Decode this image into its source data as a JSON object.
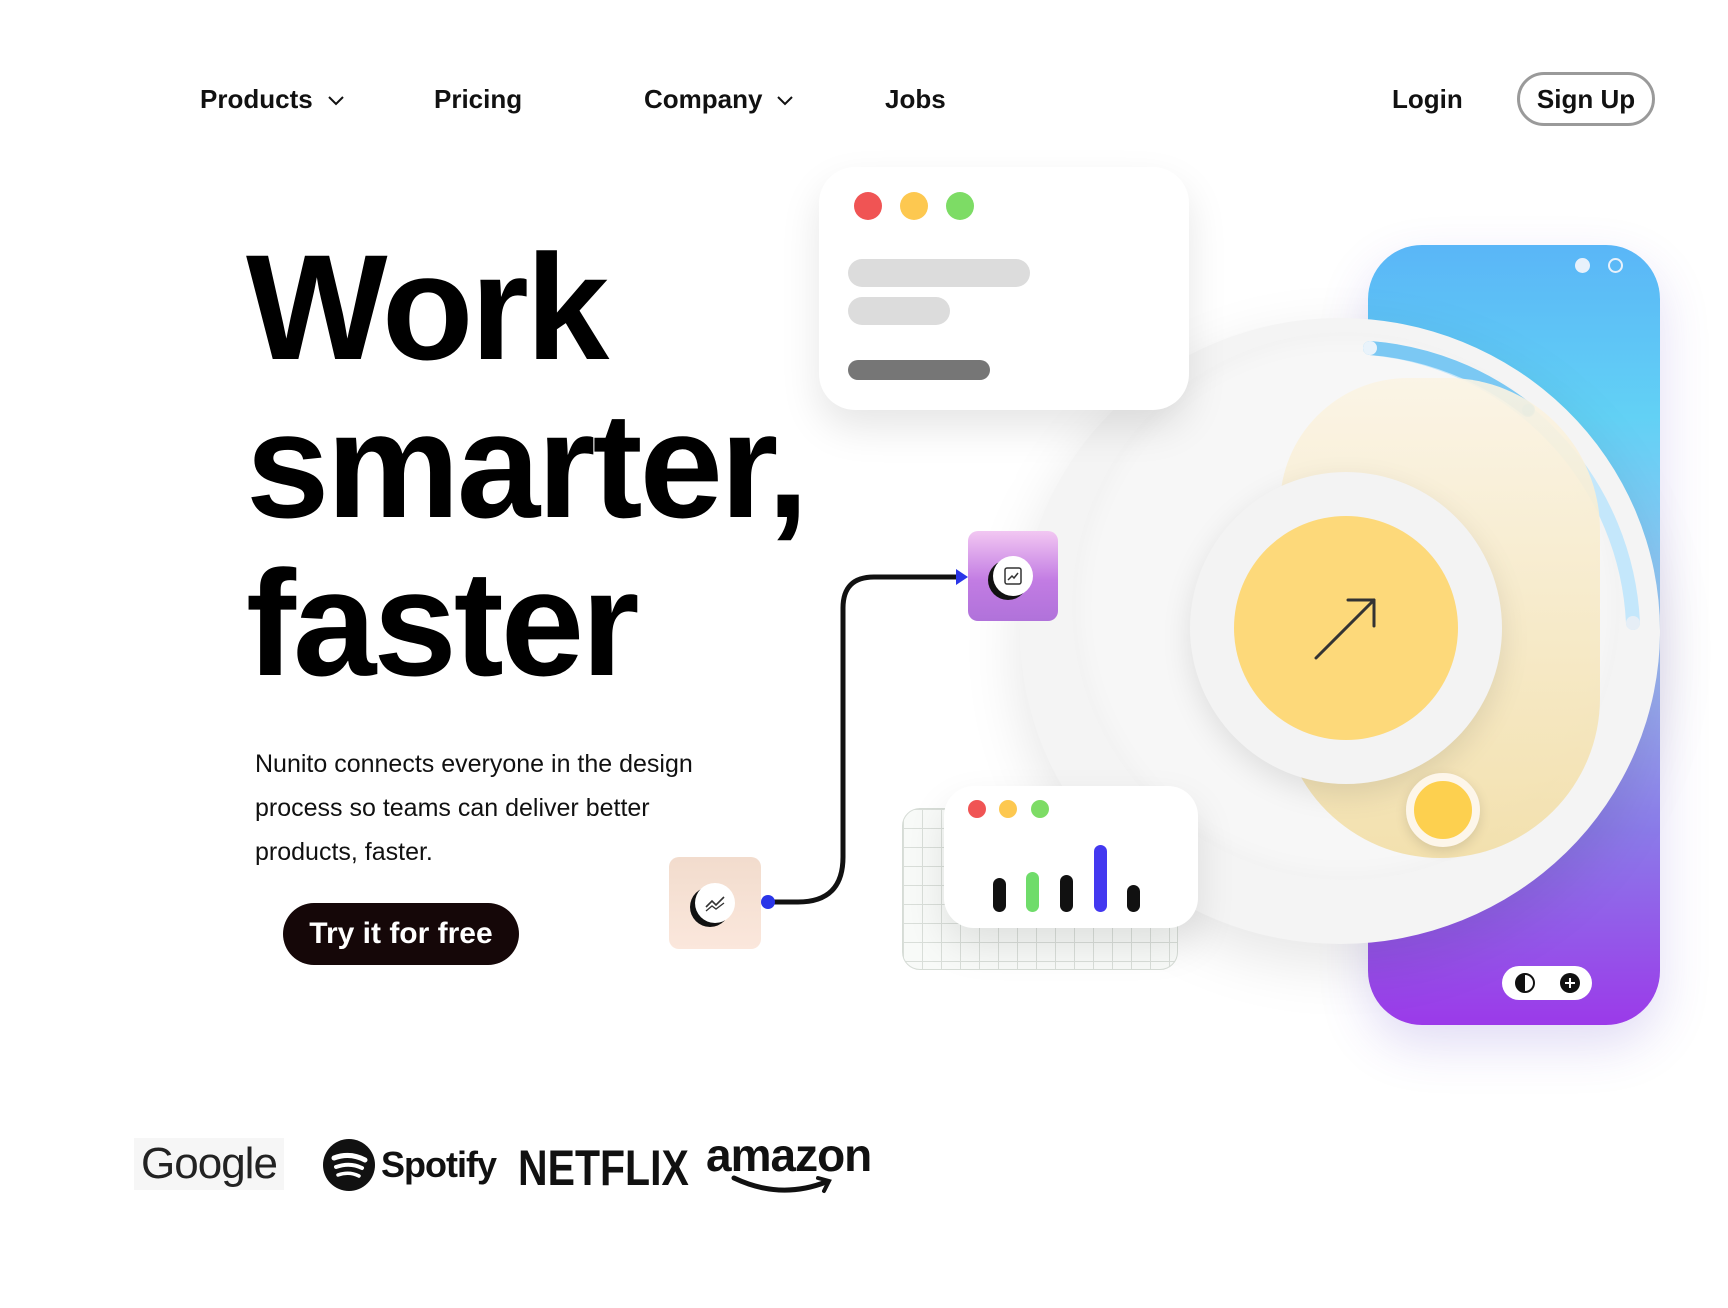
{
  "nav": {
    "products": "Products",
    "pricing": "Pricing",
    "company": "Company",
    "jobs": "Jobs",
    "login": "Login",
    "signup": "Sign Up"
  },
  "hero": {
    "title_line1": "Work",
    "title_line2": "smarter,",
    "title_line3": "faster",
    "subtitle": "Nunito connects everyone in the design process so teams can deliver better products, faster.",
    "cta": "Try it for free"
  },
  "logos": {
    "google": "Google",
    "spotify": "Spotify",
    "netflix": "NETFLIX",
    "amazon": "amazon"
  },
  "icons": {
    "products_chevron": "chevron-down-icon",
    "company_chevron": "chevron-down-icon",
    "arrow": "arrow-up-right-icon",
    "trend": "trend-icon",
    "chart": "chart-icon",
    "theme": "contrast-icon",
    "add": "plus-icon"
  },
  "colors": {
    "cta_bg": "#150708",
    "traffic_red": "#f05454",
    "traffic_yellow": "#fdc850",
    "traffic_green": "#7ddc65",
    "chart_blue": "#4338f0",
    "sun": "#fdd97a"
  }
}
